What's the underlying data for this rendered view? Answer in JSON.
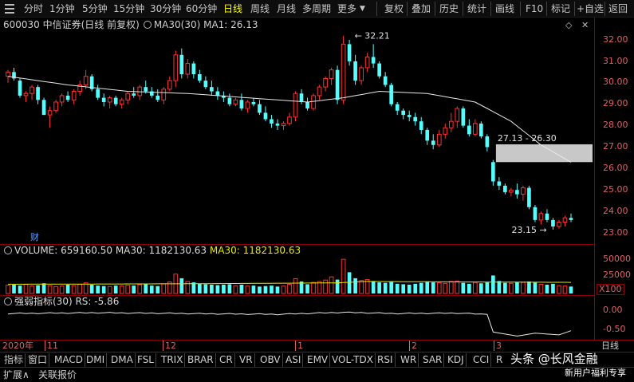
{
  "toolbar": {
    "items": [
      "分时",
      "1分钟",
      "5分钟",
      "15分钟",
      "30分钟",
      "60分钟",
      "日线",
      "周线",
      "月线",
      "多周期",
      "更多"
    ],
    "active": "日线",
    "right_items": [
      "复权",
      "叠加",
      "历史",
      "统计",
      "画线",
      "F10",
      "标记",
      "+自选",
      "返回"
    ]
  },
  "info": {
    "symbol": "600030 中信证券(日线 前复权)",
    "ma_label": "MA30(30)",
    "ma_value": "MA1: 26.13"
  },
  "price_axis": [
    "32.00",
    "31.00",
    "30.00",
    "29.00",
    "28.00",
    "27.00",
    "26.00",
    "25.00",
    "24.00",
    "23.00"
  ],
  "annotations": {
    "high": "32.21",
    "low": "23.15",
    "gap": "27.13 - 26.30",
    "finance_marker": "财"
  },
  "volume": {
    "label": "VOLUME: 659160.50",
    "ma_label": "MA30: 1182130.63",
    "ma_label2": "MA30: 1182130.63",
    "axis": [
      "50000",
      "25000"
    ],
    "unit": "X100"
  },
  "indicator": {
    "name": "强弱指标(30)",
    "rs": "RS: -5.86",
    "axis": [
      "0.00",
      "-0.50"
    ]
  },
  "date_axis": {
    "labels": [
      "2020年",
      "11",
      "12",
      "1",
      "2",
      "3"
    ],
    "period": "日线"
  },
  "tabs": [
    "指标",
    "窗口",
    "MACD",
    "DMI",
    "DMA",
    "FSL",
    "TRIX",
    "BRAR",
    "CR",
    "VR",
    "OBV",
    "ASI",
    "EMV",
    "VOL-TDX",
    "RSI",
    "WR",
    "SAR",
    "KDJ",
    "CCI",
    "R"
  ],
  "footer": {
    "expand": "扩展∧",
    "related": "关联报价"
  },
  "watermark": {
    "text": "头条 @长风金融",
    "sub": "新用户福利专享"
  },
  "colors": {
    "up": "#ff3232",
    "down": "#54ffff",
    "ma": "#e8e8e8",
    "vol_ma": "#e8e800",
    "axis": "#8b0000"
  },
  "chart_data": {
    "type": "candlestick",
    "y_range": [
      22.8,
      32.4
    ],
    "ohlc": [
      [
        30.3,
        30.6,
        30.0,
        30.5
      ],
      [
        30.5,
        30.7,
        30.1,
        30.2
      ],
      [
        30.1,
        30.2,
        29.3,
        29.4
      ],
      [
        29.4,
        29.6,
        29.1,
        29.5
      ],
      [
        29.5,
        29.9,
        29.2,
        29.8
      ],
      [
        29.8,
        29.9,
        29.0,
        29.2
      ],
      [
        29.2,
        29.3,
        28.5,
        28.5
      ],
      [
        28.5,
        28.9,
        27.9,
        28.7
      ],
      [
        28.7,
        29.2,
        28.6,
        29.1
      ],
      [
        29.1,
        29.5,
        28.9,
        29.4
      ],
      [
        29.4,
        29.6,
        29.1,
        29.2
      ],
      [
        29.2,
        29.7,
        29.0,
        29.6
      ],
      [
        29.6,
        30.1,
        29.4,
        29.9
      ],
      [
        29.9,
        30.6,
        29.7,
        30.3
      ],
      [
        30.3,
        30.4,
        29.6,
        29.7
      ],
      [
        29.7,
        29.9,
        29.2,
        29.3
      ],
      [
        29.3,
        29.5,
        28.9,
        29.1
      ],
      [
        29.1,
        29.4,
        28.8,
        29.3
      ],
      [
        29.3,
        29.4,
        28.9,
        29.0
      ],
      [
        29.0,
        29.3,
        28.8,
        29.2
      ],
      [
        29.2,
        29.6,
        29.0,
        29.5
      ],
      [
        29.5,
        29.8,
        29.3,
        29.4
      ],
      [
        29.4,
        29.9,
        29.2,
        29.8
      ],
      [
        29.8,
        30.1,
        29.5,
        29.6
      ],
      [
        29.6,
        29.8,
        29.3,
        29.4
      ],
      [
        29.4,
        29.7,
        29.1,
        29.2
      ],
      [
        29.2,
        29.8,
        29.0,
        29.7
      ],
      [
        29.7,
        30.3,
        29.6,
        30.1
      ],
      [
        30.1,
        31.5,
        29.8,
        31.3
      ],
      [
        31.3,
        31.6,
        30.2,
        30.4
      ],
      [
        30.4,
        31.1,
        30.2,
        30.9
      ],
      [
        30.9,
        31.0,
        30.2,
        30.4
      ],
      [
        30.4,
        30.6,
        30.0,
        30.1
      ],
      [
        30.1,
        30.3,
        29.7,
        29.8
      ],
      [
        29.8,
        30.1,
        29.4,
        29.6
      ],
      [
        29.6,
        29.8,
        29.2,
        29.4
      ],
      [
        29.4,
        29.6,
        29.1,
        29.3
      ],
      [
        29.3,
        29.5,
        28.9,
        29.0
      ],
      [
        29.0,
        29.3,
        28.9,
        29.2
      ],
      [
        29.2,
        29.5,
        28.7,
        28.8
      ],
      [
        28.8,
        29.2,
        28.6,
        29.1
      ],
      [
        29.1,
        29.3,
        28.9,
        29.0
      ],
      [
        29.0,
        29.2,
        28.5,
        28.6
      ],
      [
        28.6,
        28.9,
        28.2,
        28.3
      ],
      [
        28.3,
        28.5,
        27.9,
        28.1
      ],
      [
        28.1,
        28.3,
        27.8,
        28.0
      ],
      [
        28.0,
        28.2,
        27.8,
        28.1
      ],
      [
        28.1,
        28.6,
        28.0,
        28.4
      ],
      [
        28.4,
        29.6,
        28.2,
        29.5
      ],
      [
        29.5,
        29.7,
        29.0,
        29.1
      ],
      [
        29.1,
        29.3,
        28.7,
        28.8
      ],
      [
        28.8,
        29.5,
        28.7,
        29.4
      ],
      [
        29.4,
        29.9,
        29.2,
        29.8
      ],
      [
        29.8,
        30.3,
        29.6,
        30.2
      ],
      [
        30.2,
        30.7,
        29.9,
        30.6
      ],
      [
        30.6,
        30.8,
        29.0,
        29.2
      ],
      [
        29.2,
        32.2,
        29.0,
        31.8
      ],
      [
        31.8,
        32.0,
        30.8,
        31.0
      ],
      [
        31.0,
        31.3,
        29.9,
        30.1
      ],
      [
        30.1,
        30.8,
        29.9,
        30.7
      ],
      [
        30.7,
        31.4,
        30.5,
        31.2
      ],
      [
        31.2,
        31.8,
        30.7,
        30.9
      ],
      [
        30.9,
        31.0,
        30.2,
        30.3
      ],
      [
        30.3,
        30.5,
        29.8,
        29.9
      ],
      [
        29.9,
        30.0,
        28.9,
        29.0
      ],
      [
        29.0,
        29.1,
        28.5,
        28.7
      ],
      [
        28.7,
        28.8,
        28.3,
        28.5
      ],
      [
        28.5,
        28.7,
        28.2,
        28.4
      ],
      [
        28.4,
        28.6,
        28.0,
        28.2
      ],
      [
        28.2,
        28.4,
        27.6,
        27.8
      ],
      [
        27.8,
        27.9,
        27.1,
        27.3
      ],
      [
        27.3,
        27.6,
        26.9,
        27.1
      ],
      [
        27.1,
        27.8,
        27.0,
        27.6
      ],
      [
        27.6,
        28.1,
        27.4,
        27.9
      ],
      [
        27.9,
        28.6,
        27.7,
        28.2
      ],
      [
        28.2,
        28.9,
        27.9,
        28.8
      ],
      [
        28.8,
        28.9,
        27.9,
        28.0
      ],
      [
        28.0,
        28.3,
        27.5,
        27.6
      ],
      [
        27.6,
        28.3,
        27.5,
        28.1
      ],
      [
        28.1,
        28.2,
        27.4,
        27.5
      ],
      [
        27.5,
        27.6,
        26.8,
        27.0
      ],
      [
        26.3,
        26.4,
        25.2,
        25.4
      ],
      [
        25.4,
        25.6,
        25.0,
        25.2
      ],
      [
        25.2,
        25.3,
        24.8,
        24.9
      ],
      [
        24.9,
        25.1,
        24.7,
        25.0
      ],
      [
        25.0,
        25.3,
        24.6,
        24.8
      ],
      [
        24.8,
        25.2,
        24.5,
        25.1
      ],
      [
        25.1,
        25.2,
        24.1,
        24.2
      ],
      [
        24.2,
        24.3,
        23.5,
        23.6
      ],
      [
        23.6,
        24.0,
        23.4,
        23.9
      ],
      [
        23.9,
        24.1,
        23.5,
        23.6
      ],
      [
        23.6,
        23.7,
        23.15,
        23.3
      ],
      [
        23.3,
        23.6,
        23.2,
        23.5
      ],
      [
        23.5,
        23.8,
        23.3,
        23.7
      ],
      [
        23.7,
        23.9,
        23.5,
        23.6
      ]
    ],
    "ma30_anchors": [
      [
        0,
        30.3
      ],
      [
        10,
        29.9
      ],
      [
        20,
        29.6
      ],
      [
        30,
        29.5
      ],
      [
        40,
        29.3
      ],
      [
        50,
        29.1
      ],
      [
        56,
        29.3
      ],
      [
        62,
        29.6
      ],
      [
        70,
        29.5
      ],
      [
        78,
        29.1
      ],
      [
        84,
        28.2
      ],
      [
        89,
        27.1
      ],
      [
        95,
        26.13
      ]
    ],
    "gap_box": [
      26.3,
      27.13
    ],
    "volume_values": [
      180,
      190,
      170,
      200,
      160,
      180,
      220,
      170,
      150,
      160,
      190,
      170,
      200,
      230,
      190,
      170,
      160,
      150,
      170,
      160,
      180,
      170,
      190,
      200,
      170,
      160,
      210,
      250,
      420,
      330,
      260,
      240,
      210,
      200,
      190,
      180,
      190,
      200,
      170,
      190,
      160,
      170,
      150,
      160,
      170,
      150,
      160,
      200,
      320,
      260,
      200,
      240,
      260,
      290,
      360,
      300,
      740,
      460,
      330,
      280,
      300,
      270,
      240,
      230,
      250,
      210,
      200,
      190,
      210,
      230,
      260,
      240,
      230,
      220,
      260,
      270,
      230,
      210,
      240,
      220,
      240,
      390,
      270,
      230,
      220,
      250,
      240,
      260,
      240,
      200,
      190,
      210,
      170,
      160,
      150
    ],
    "vol_ma_anchors": [
      [
        0,
        200
      ],
      [
        30,
        210
      ],
      [
        55,
        230
      ],
      [
        60,
        260
      ],
      [
        75,
        250
      ],
      [
        95,
        240
      ]
    ],
    "vol_range": [
      0,
      760
    ],
    "rs_anchors": [
      [
        0,
        0.0
      ],
      [
        15,
        0.02
      ],
      [
        30,
        0.0
      ],
      [
        45,
        -0.02
      ],
      [
        56,
        0.03
      ],
      [
        65,
        0.0
      ],
      [
        75,
        0.01
      ],
      [
        80,
        -0.02
      ],
      [
        81,
        -0.45
      ],
      [
        85,
        -0.55
      ],
      [
        88,
        -0.48
      ],
      [
        92,
        -0.52
      ],
      [
        94,
        -0.42
      ],
      [
        95,
        -0.45
      ]
    ],
    "rs_range": [
      -0.6,
      0.1
    ]
  }
}
